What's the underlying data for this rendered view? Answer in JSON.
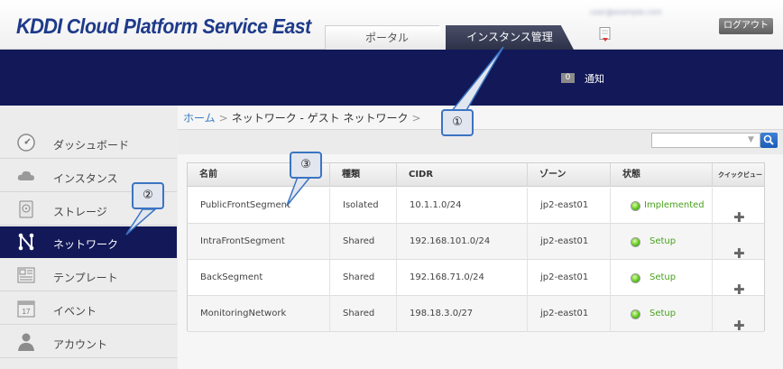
{
  "header": {
    "brand": "KDDI Cloud Platform Service East",
    "brand_mark": "KDDI",
    "brand_rest": " Cloud Platform Service East",
    "user_email": "user@example.com",
    "logout_label": "ログアウト",
    "tabs": [
      {
        "label": "ポータル",
        "active": false
      },
      {
        "label": "インスタンス管理",
        "active": true
      }
    ],
    "notification_count": "0",
    "notification_label": "通知"
  },
  "sidebar": {
    "items": [
      {
        "label": "ダッシュボード",
        "icon": "dashboard-gauge-icon",
        "active": false
      },
      {
        "label": "インスタンス",
        "icon": "cloud-icon",
        "active": false
      },
      {
        "label": "ストレージ",
        "icon": "storage-disk-icon",
        "active": false
      },
      {
        "label": "ネットワーク",
        "icon": "network-icon",
        "active": true
      },
      {
        "label": "テンプレート",
        "icon": "template-icon",
        "active": false
      },
      {
        "label": "イベント",
        "icon": "calendar-icon",
        "active": false
      },
      {
        "label": "アカウント",
        "icon": "account-person-icon",
        "active": false
      }
    ]
  },
  "breadcrumb": {
    "home": "ホーム",
    "current": "ネットワーク - ゲスト ネットワーク",
    "separator": ">"
  },
  "search": {
    "value": "",
    "placeholder": ""
  },
  "table": {
    "columns": [
      "名前",
      "種類",
      "CIDR",
      "ゾーン",
      "状態",
      "クイックビュー"
    ],
    "rows": [
      {
        "name": "PublicFrontSegment",
        "type": "Isolated",
        "cidr": "10.1.1.0/24",
        "zone": "jp2-east01",
        "status": "Implemented"
      },
      {
        "name": "IntraFrontSegment",
        "type": "Shared",
        "cidr": "192.168.101.0/24",
        "zone": "jp2-east01",
        "status": "Setup"
      },
      {
        "name": "BackSegment",
        "type": "Shared",
        "cidr": "192.168.71.0/24",
        "zone": "jp2-east01",
        "status": "Setup"
      },
      {
        "name": "MonitoringNetwork",
        "type": "Shared",
        "cidr": "198.18.3.0/27",
        "zone": "jp2-east01",
        "status": "Setup"
      }
    ],
    "quickview_glyph": "✚"
  },
  "callouts": [
    "①",
    "②",
    "③"
  ],
  "colors": {
    "brand_blue": "#1d3a8a",
    "band_navy": "#121858",
    "link_blue": "#3a7cc4",
    "status_green": "#4aa21c",
    "callout_border": "#3b74c2"
  }
}
